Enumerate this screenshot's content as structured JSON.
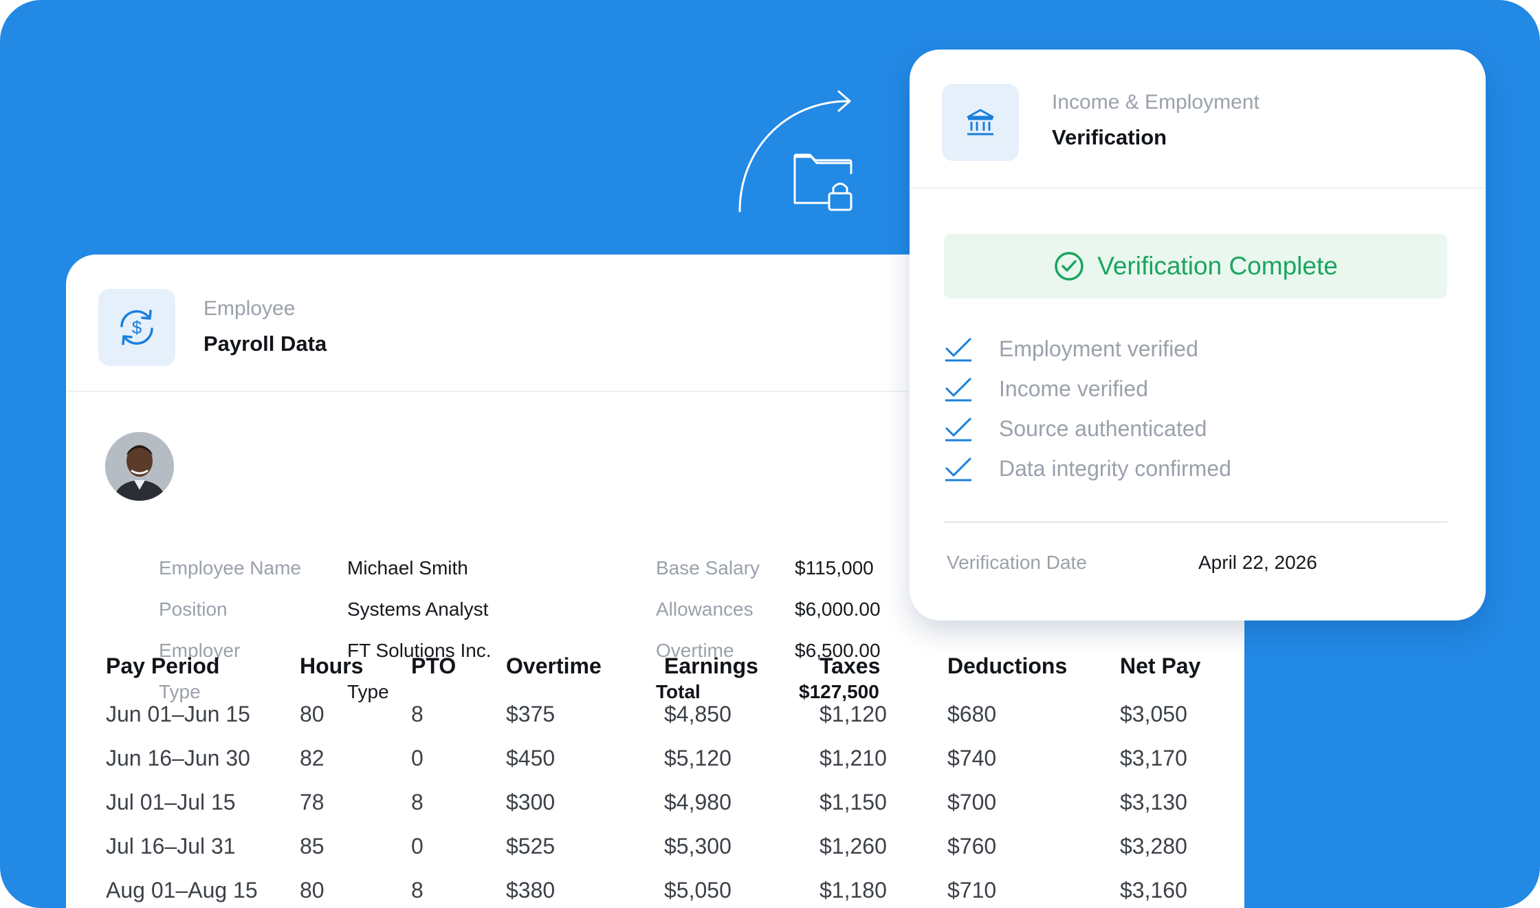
{
  "payroll_card": {
    "header_sub": "Employee",
    "header_title": "Payroll Data",
    "icon": "dollar-cycle-icon"
  },
  "employee": {
    "fields": [
      {
        "label": "Employee Name",
        "value": "Michael Smith"
      },
      {
        "label": "Position",
        "value": "Systems Analyst"
      },
      {
        "label": "Employer",
        "value": "FT Solutions Inc."
      },
      {
        "label": "Type",
        "value": "Type"
      }
    ],
    "pay": [
      {
        "label": "Base Salary",
        "value": "$115,000"
      },
      {
        "label": "Allowances",
        "value": "$6,000.00"
      },
      {
        "label": "Overtime",
        "value": "$6,500.00"
      },
      {
        "label": "Total",
        "value": "$127,500"
      }
    ]
  },
  "pay_table": {
    "columns": [
      "Pay Period",
      "Hours",
      "PTO",
      "Overtime",
      "Earnings",
      "Taxes",
      "Deductions",
      "Net Pay"
    ],
    "rows": [
      [
        "Jun 01–Jun 15",
        "80",
        "8",
        "$375",
        "$4,850",
        "$1,120",
        "$680",
        "$3,050"
      ],
      [
        "Jun 16–Jun 30",
        "82",
        "0",
        "$450",
        "$5,120",
        "$1,210",
        "$740",
        "$3,170"
      ],
      [
        "Jul 01–Jul 15",
        "78",
        "8",
        "$300",
        "$4,980",
        "$1,150",
        "$700",
        "$3,130"
      ],
      [
        "Jul 16–Jul 31",
        "85",
        "0",
        "$525",
        "$5,300",
        "$1,260",
        "$760",
        "$3,280"
      ],
      [
        "Aug 01–Aug 15",
        "80",
        "8",
        "$380",
        "$5,050",
        "$1,180",
        "$710",
        "$3,160"
      ]
    ]
  },
  "verification_card": {
    "header_sub": "Income & Employment",
    "header_title": "Verification",
    "icon": "bank-icon",
    "status": "Verification Complete",
    "checks": [
      "Employment verified",
      "Income verified",
      "Source authenticated",
      "Data integrity confirmed"
    ],
    "date_label": "Verification Date",
    "date_value": "April 22, 2026"
  },
  "colors": {
    "background": "#2289e5",
    "accent": "#1a7fdc",
    "success": "#1aa55f",
    "success_bg": "#e9f7ef"
  }
}
